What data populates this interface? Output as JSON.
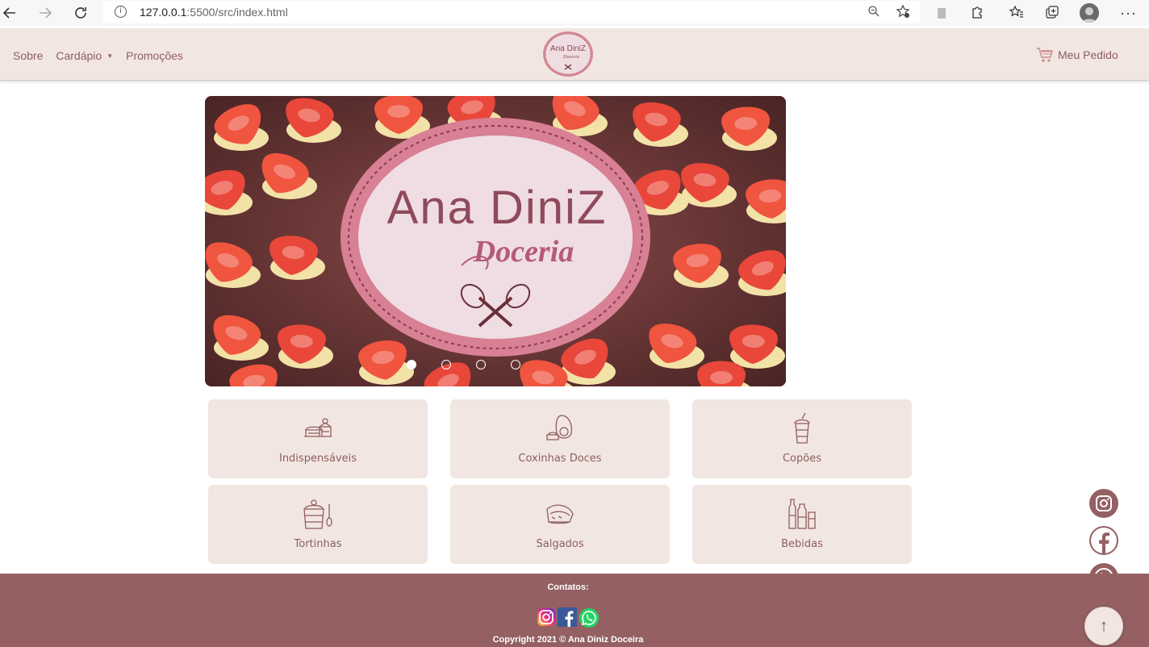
{
  "browser": {
    "url_host": "127.0.0.1",
    "url_rest": ":5500/src/index.html"
  },
  "header": {
    "nav": [
      {
        "label": "Sobre"
      },
      {
        "label": "Cardápio"
      },
      {
        "label": "Promoções"
      }
    ],
    "logo_text_1": "Ana DiniZ",
    "logo_text_2": "Doceria",
    "cart_label": "Meu Pedido"
  },
  "carousel": {
    "logo_title": "Ana DiniZ",
    "logo_subtitle": "Doceria",
    "slide_count": 4,
    "active_slide": 1
  },
  "categories": [
    {
      "label": "Indispensáveis",
      "icon": "cake-slice-icon"
    },
    {
      "label": "Coxinhas Doces",
      "icon": "avocado-dessert-icon"
    },
    {
      "label": "Copões",
      "icon": "milkshake-cup-icon"
    },
    {
      "label": "Tortinhas",
      "icon": "dessert-cup-icon"
    },
    {
      "label": "Salgados",
      "icon": "pie-slice-icon"
    },
    {
      "label": "Bebidas",
      "icon": "bottles-icon"
    }
  ],
  "footer": {
    "contacts_label": "Contatos:",
    "copyright": "Copyright 2021 © Ana Diniz Doceira"
  },
  "colors": {
    "brand": "#946062",
    "header_bg": "#f2e6e2",
    "text_accent": "#8f5e5c"
  }
}
